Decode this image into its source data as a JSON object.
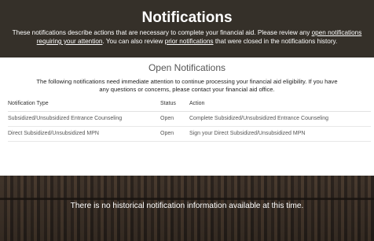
{
  "header": {
    "title": "Notifications",
    "intro_prefix": "These notifications describe actions that are necessary to complete your financial aid. Please review any",
    "open_link": "open notifications requiring your attention",
    "intro_middle": ". You can also review",
    "prior_link": "prior notifications",
    "intro_suffix": "that were closed in the notifications history."
  },
  "open_notifications": {
    "title": "Open Notifications",
    "description": "The following notifications need immediate attention to continue processing your financial aid eligibility. If you have any questions or concerns, please contact your financial aid office.",
    "columns": [
      "Notification Type",
      "Status",
      "Action"
    ],
    "rows": [
      {
        "type": "Subsidized/Unsubsidized Entrance Counseling",
        "status": "Open",
        "action": "Complete Subsidized/Unsubsidized Entrance Counseling"
      },
      {
        "type": "Direct Subsidized/Unsubsidized MPN",
        "status": "Open",
        "action": "Sign your Direct Subsidized/Unsubsidized MPN"
      }
    ]
  },
  "history": {
    "message": "There is no historical notification information available at this time."
  },
  "colors": {
    "header_bg": "#353029",
    "panel_bg": "#ffffff"
  }
}
